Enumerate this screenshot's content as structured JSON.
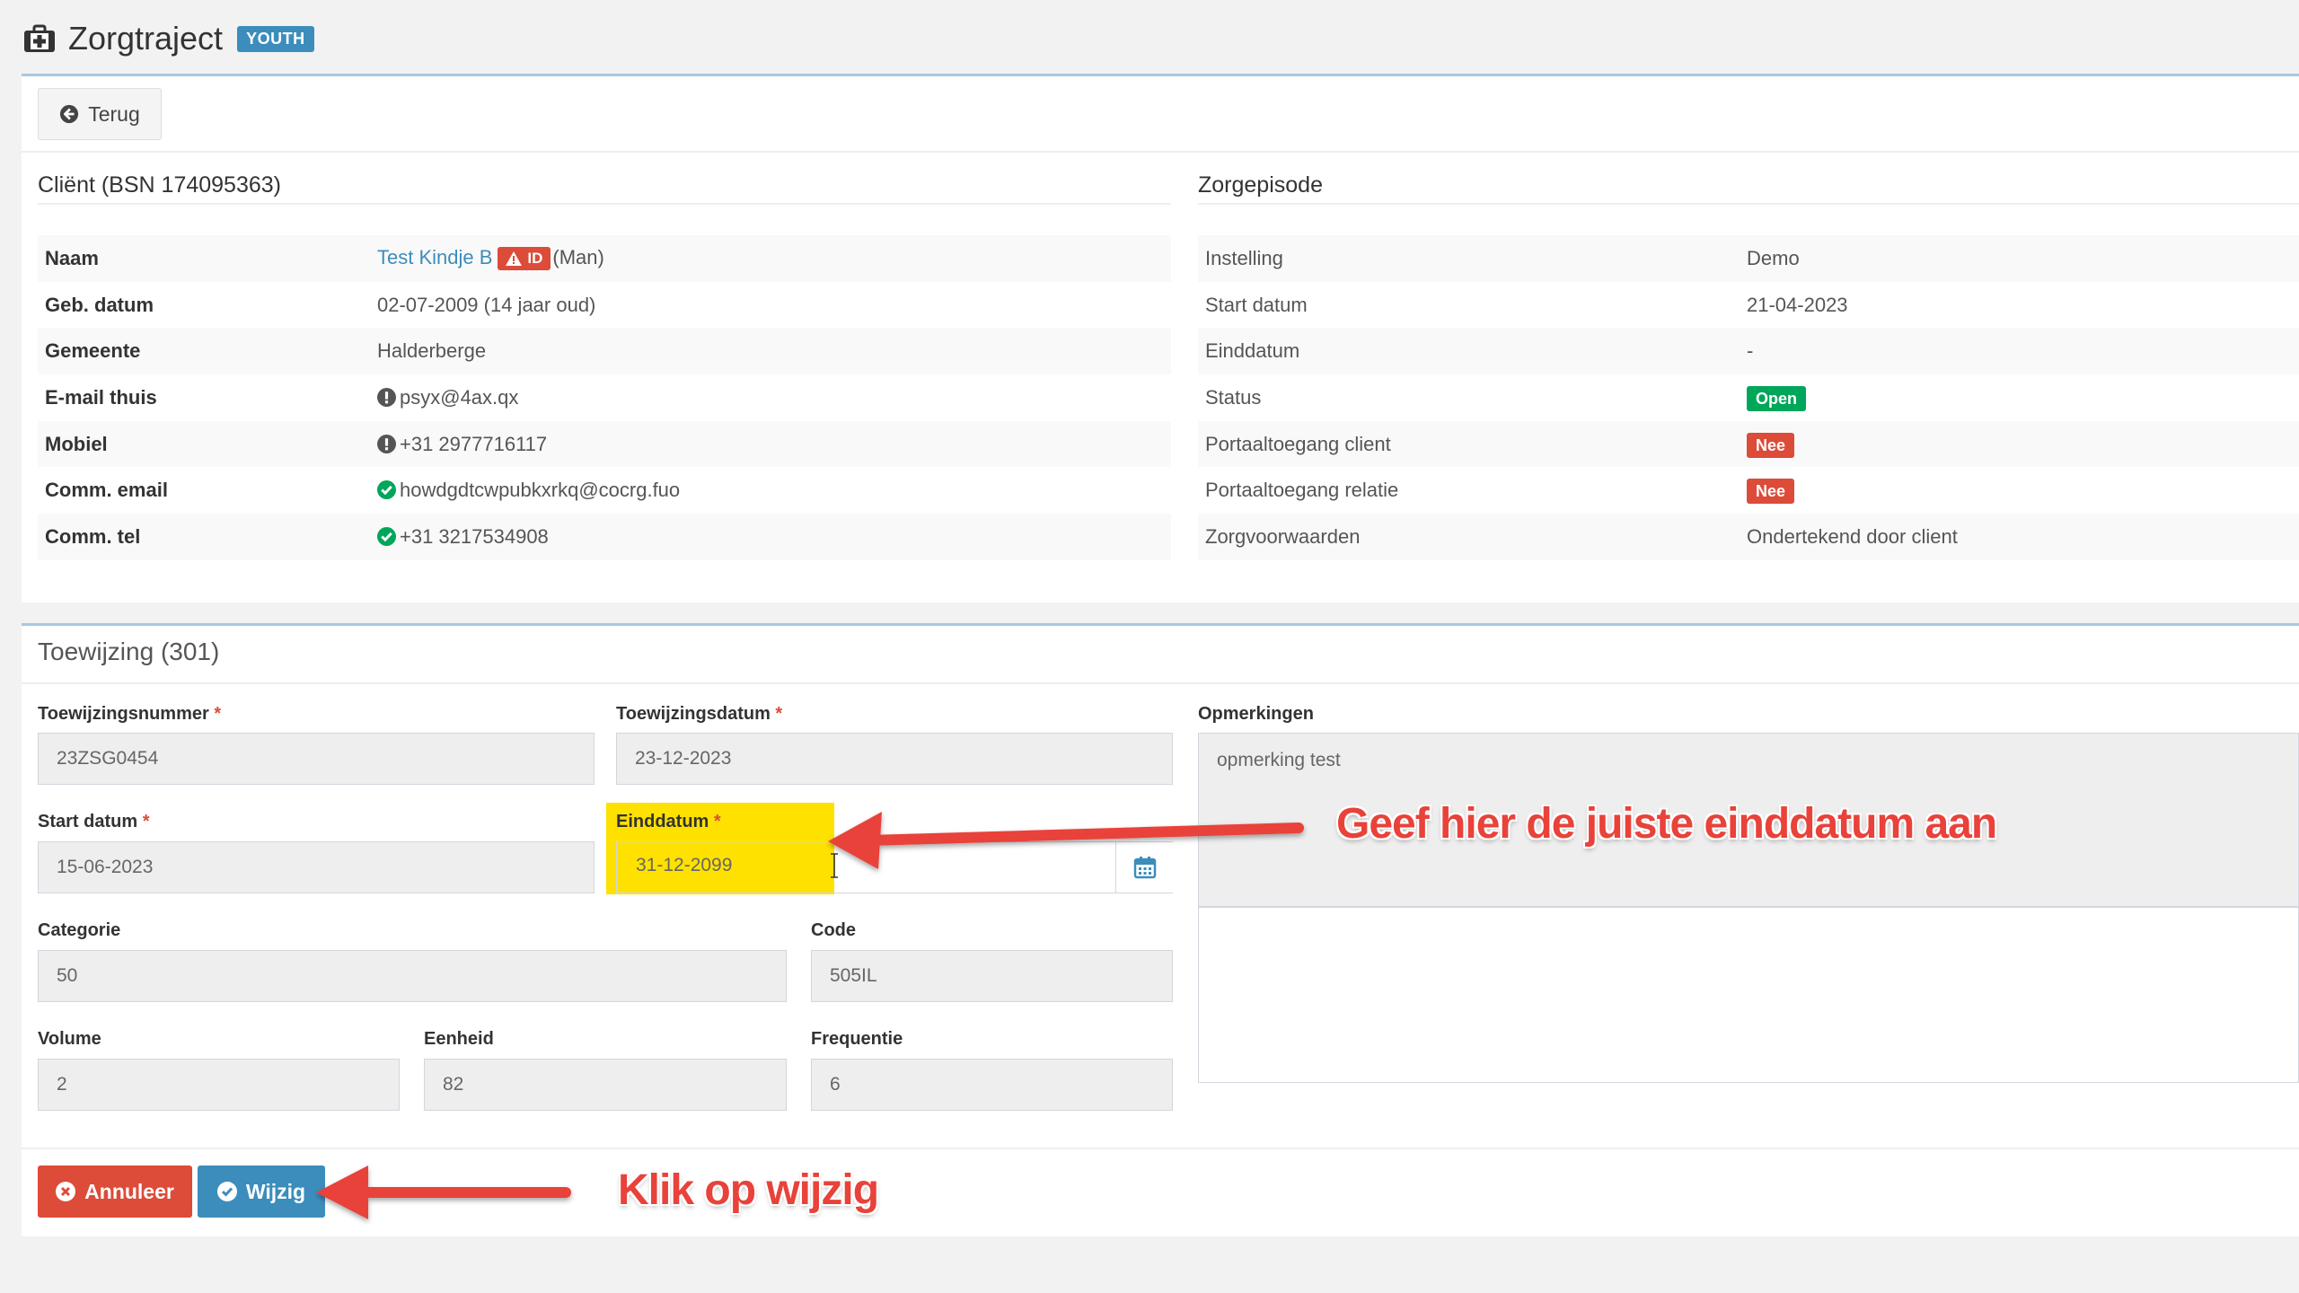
{
  "header": {
    "title": "Zorgtraject",
    "badge": "YOUTH"
  },
  "back_button": {
    "label": "Terug"
  },
  "client": {
    "title": "Cliënt (BSN 174095363)",
    "rows": [
      {
        "label": "Naam",
        "name": "Test Kindje B",
        "id_badge": "ID",
        "gender": "(Man)"
      },
      {
        "label": "Geb. datum",
        "value": "02-07-2009 (14 jaar oud)"
      },
      {
        "label": "Gemeente",
        "value": "Halderberge"
      },
      {
        "label": "E-mail thuis",
        "value": "psyx@4ax.qx"
      },
      {
        "label": "Mobiel",
        "value": "+31 2977716117"
      },
      {
        "label": "Comm. email",
        "value": "howdgdtcwpubkxrkq@cocrg.fuo"
      },
      {
        "label": "Comm. tel",
        "value": "+31 3217534908"
      }
    ]
  },
  "episode": {
    "title": "Zorgepisode",
    "rows": [
      {
        "label": "Instelling",
        "value": "Demo"
      },
      {
        "label": "Start datum",
        "value": "21-04-2023"
      },
      {
        "label": "Einddatum",
        "value": "-"
      },
      {
        "label": "Status",
        "value": "Open"
      },
      {
        "label": "Portaaltoegang client",
        "value": "Nee"
      },
      {
        "label": "Portaaltoegang relatie",
        "value": "Nee"
      },
      {
        "label": "Zorgvoorwaarden",
        "value": "Ondertekend door client"
      }
    ]
  },
  "form": {
    "title": "Toewijzing (301)",
    "toewijzingsnummer": {
      "label": "Toewijzingsnummer",
      "value": "23ZSG0454"
    },
    "toewijzingsdatum": {
      "label": "Toewijzingsdatum",
      "value": "23-12-2023"
    },
    "startdatum": {
      "label": "Start datum",
      "value": "15-06-2023"
    },
    "einddatum": {
      "label": "Einddatum",
      "value": "31-12-2099"
    },
    "categorie": {
      "label": "Categorie",
      "value": "50"
    },
    "code": {
      "label": "Code",
      "value": "505IL"
    },
    "volume": {
      "label": "Volume",
      "value": "2"
    },
    "eenheid": {
      "label": "Eenheid",
      "value": "82"
    },
    "frequentie": {
      "label": "Frequentie",
      "value": "6"
    },
    "opmerkingen": {
      "label": "Opmerkingen",
      "value": "opmerking test"
    },
    "required_mark": "*",
    "cancel_label": "Annuleer",
    "edit_label": "Wijzig"
  },
  "annotations": {
    "einddatum_hint": "Geef hier de juiste einddatum aan",
    "wijzig_hint": "Klik op wijzig"
  },
  "colors": {
    "primary": "#3c8dbc",
    "danger": "#dd4b39",
    "success": "#00a65a",
    "highlight": "#ffe100",
    "annotation": "#e8423a"
  },
  "icons": {
    "header": "medkit-icon",
    "back": "arrow-circle-left-icon",
    "warning": "exclamation-circle-icon",
    "verified": "check-circle-icon",
    "calendar": "calendar-icon"
  }
}
